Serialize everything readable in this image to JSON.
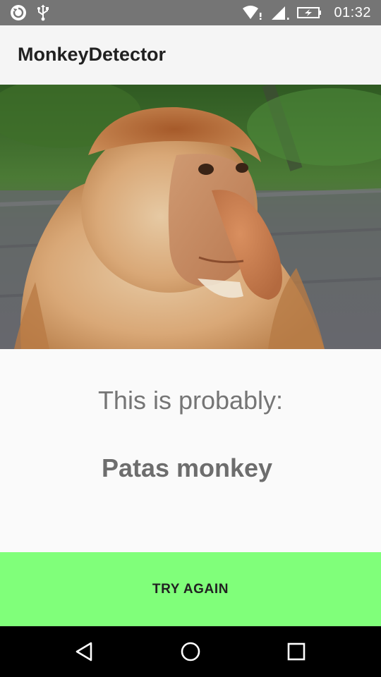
{
  "status_bar": {
    "time": "01:32",
    "icons_left": [
      "sync-icon",
      "usb-icon"
    ],
    "icons_right": [
      "wifi-icon",
      "signal-icon",
      "battery-charging-icon"
    ]
  },
  "app_bar": {
    "title": "MonkeyDetector"
  },
  "photo": {
    "subject": "proboscis-monkey-photo"
  },
  "result": {
    "intro": "This is probably:",
    "label": "Patas monkey"
  },
  "button": {
    "label": "TRY AGAIN",
    "color": "#80ff7a"
  },
  "nav_bar": {
    "buttons": [
      "back-icon",
      "home-icon",
      "recents-icon"
    ]
  },
  "colors": {
    "status_bar": "#757575",
    "app_bar": "#f5f5f5",
    "background": "#fafafa",
    "text_secondary": "#757575"
  }
}
